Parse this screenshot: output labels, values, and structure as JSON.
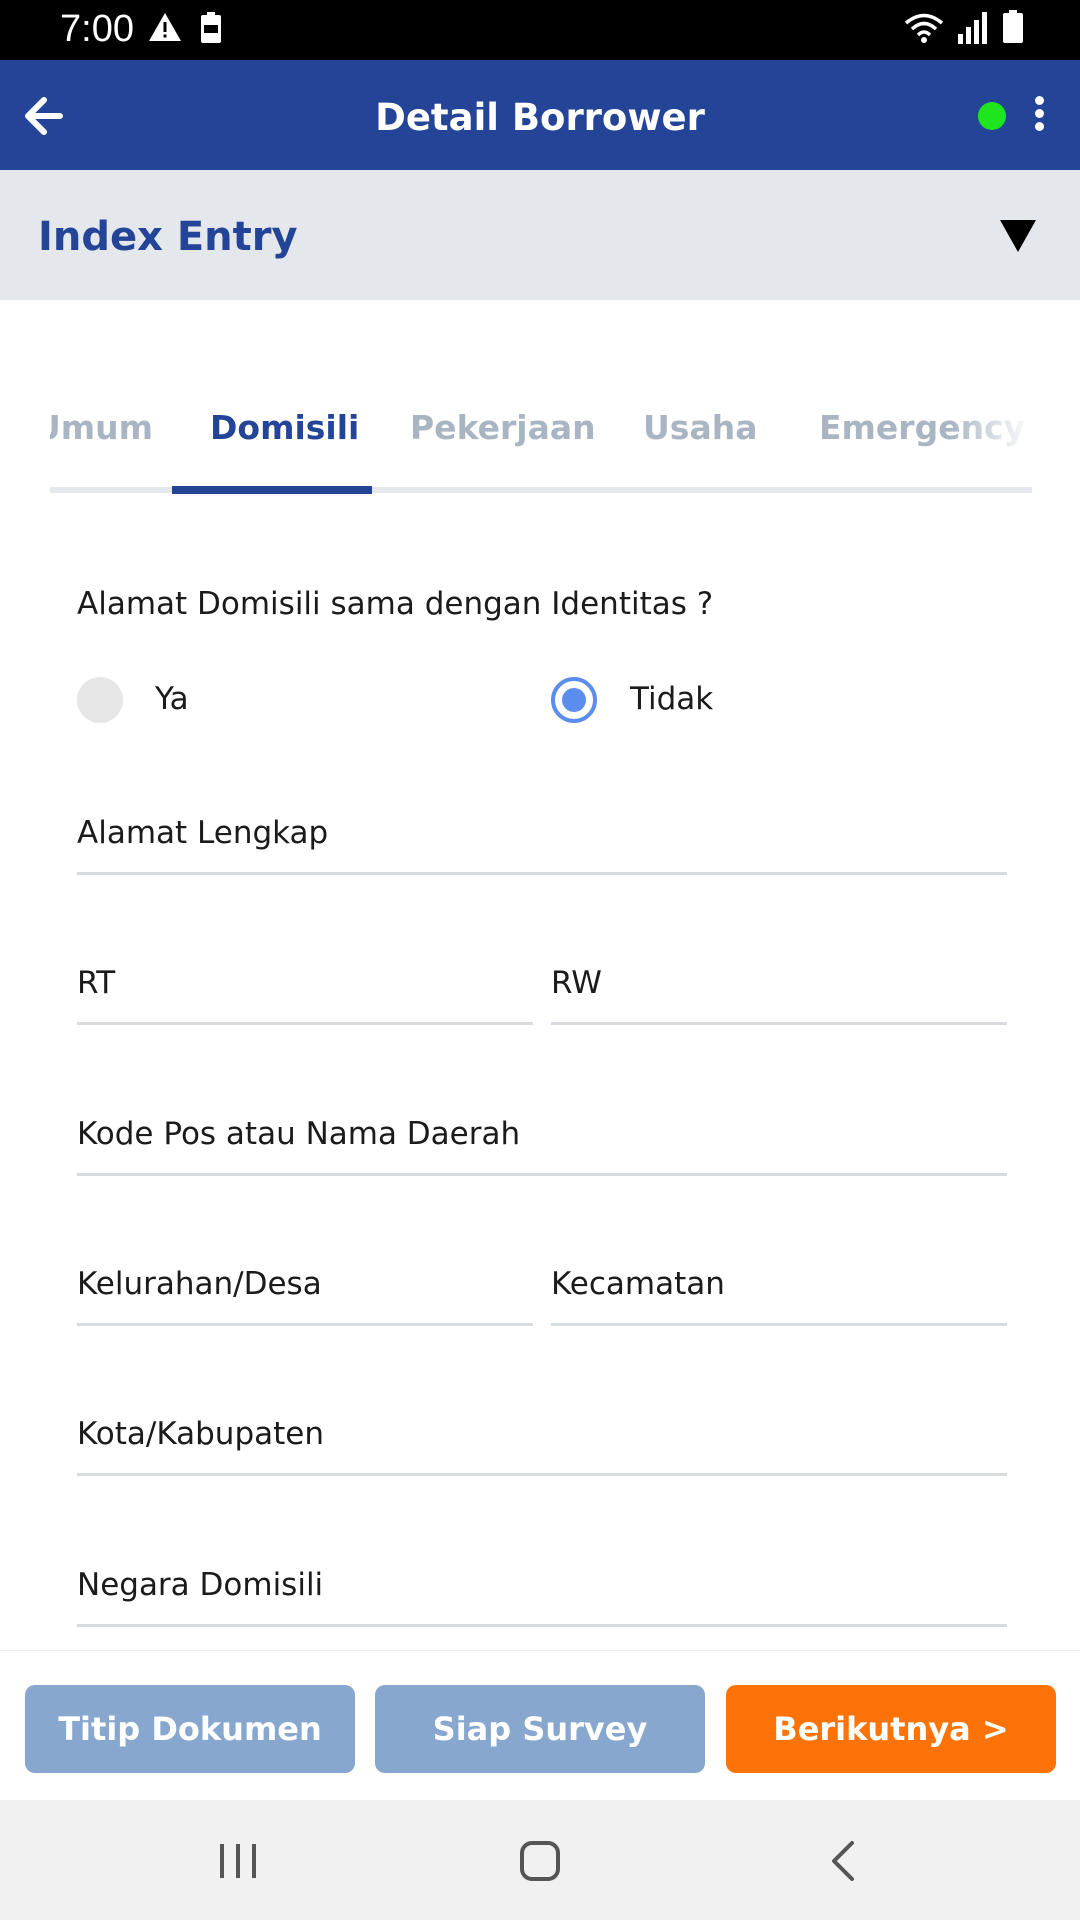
{
  "status_bar": {
    "time": "7:00",
    "left_icons": [
      "warning-icon",
      "battery-saver-icon"
    ],
    "right_icons": [
      "wifi-icon",
      "signal-icon",
      "battery-icon"
    ]
  },
  "app_bar": {
    "title": "Detail Borrower",
    "online_color": "#1ee61e"
  },
  "section": {
    "title": "Index Entry"
  },
  "tabs": [
    {
      "label": "Umum",
      "active": false
    },
    {
      "label": "Domisili",
      "active": true
    },
    {
      "label": "Pekerjaan",
      "active": false
    },
    {
      "label": "Usaha",
      "active": false
    },
    {
      "label": "Emergency",
      "active": false
    }
  ],
  "form": {
    "question": "Alamat Domisili sama dengan Identitas ?",
    "options": [
      {
        "label": "Ya",
        "selected": false
      },
      {
        "label": "Tidak",
        "selected": true
      }
    ],
    "fields": {
      "alamat_lengkap": "Alamat Lengkap",
      "rt": "RT",
      "rw": "RW",
      "kode_pos": "Kode Pos atau Nama Daerah",
      "kelurahan": "Kelurahan/Desa",
      "kecamatan": "Kecamatan",
      "kota": "Kota/Kabupaten",
      "negara": "Negara Domisili"
    }
  },
  "footer": {
    "titip_label": "Titip Dokumen",
    "siap_label": "Siap Survey",
    "next_label": "Berikutnya >"
  },
  "colors": {
    "brand": "#244597",
    "accent": "#fe7308",
    "muted_button": "#87a7cf",
    "radio": "#5b8def"
  }
}
